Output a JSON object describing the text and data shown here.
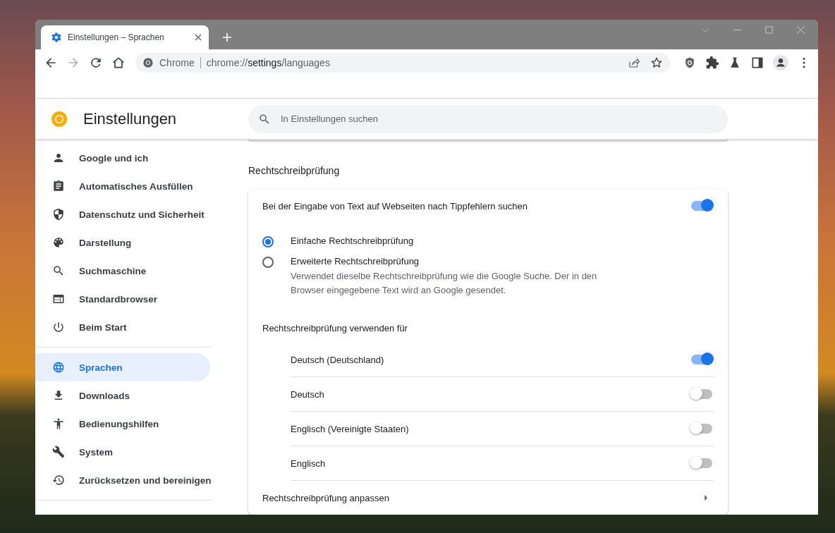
{
  "tab": {
    "title": "Einstellungen – Sprachen",
    "selected": true
  },
  "omnibox": {
    "chip": "Chrome",
    "url_scheme": "chrome://",
    "url_host": "settings",
    "url_path": "/languages"
  },
  "header": {
    "title": "Einstellungen",
    "search_placeholder": "In Einstellungen suchen"
  },
  "sidebar": {
    "items": [
      {
        "label": "Google und ich",
        "selected": false
      },
      {
        "label": "Automatisches Ausfüllen",
        "selected": false
      },
      {
        "label": "Datenschutz und Sicherheit",
        "selected": false
      },
      {
        "label": "Darstellung",
        "selected": false
      },
      {
        "label": "Suchmaschine",
        "selected": false
      },
      {
        "label": "Standardbrowser",
        "selected": false
      },
      {
        "label": "Beim Start",
        "selected": false
      },
      {
        "label": "Sprachen",
        "selected": true
      },
      {
        "label": "Downloads",
        "selected": false
      },
      {
        "label": "Bedienungshilfen",
        "selected": false
      },
      {
        "label": "System",
        "selected": false
      },
      {
        "label": "Zurücksetzen und bereinigen",
        "selected": false
      }
    ]
  },
  "section": {
    "title": "Rechtschreibprüfung",
    "main_toggle": {
      "label": "Bei der Eingabe von Text auf Webseiten nach Tippfehlern suchen",
      "on": true
    },
    "options": [
      {
        "label": "Einfache Rechtschreibprüfung",
        "selected": true
      },
      {
        "label": "Erweiterte Rechtschreibprüfung",
        "description": "Verwendet dieselbe Rechtschreibprüfung wie die Google Suche. Der in den Browser eingegebene Text wird an Google gesendet.",
        "selected": false
      }
    ],
    "languages_title": "Rechtschreibprüfung verwenden für",
    "languages": [
      {
        "label": "Deutsch (Deutschland)",
        "on": true
      },
      {
        "label": "Deutsch",
        "on": false
      },
      {
        "label": "Englisch (Vereinigte Staaten)",
        "on": false
      },
      {
        "label": "Englisch",
        "on": false
      }
    ],
    "customize": "Rechtschreibprüfung anpassen"
  }
}
